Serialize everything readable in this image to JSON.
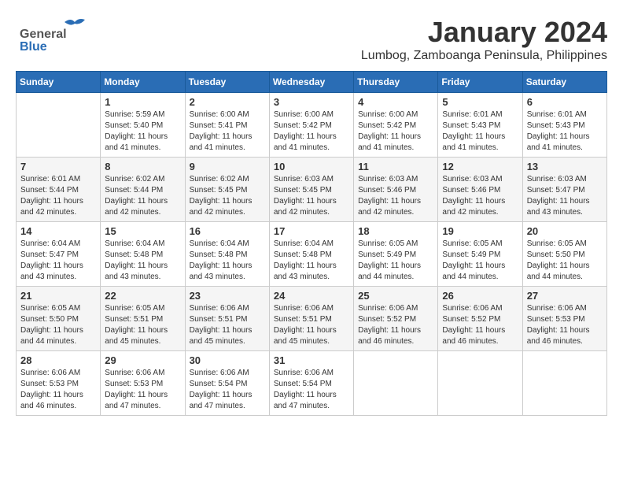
{
  "header": {
    "logo_general": "General",
    "logo_blue": "Blue",
    "month": "January 2024",
    "location": "Lumbog, Zamboanga Peninsula, Philippines"
  },
  "weekdays": [
    "Sunday",
    "Monday",
    "Tuesday",
    "Wednesday",
    "Thursday",
    "Friday",
    "Saturday"
  ],
  "weeks": [
    [
      {
        "day": "",
        "sunrise": "",
        "sunset": "",
        "daylight": ""
      },
      {
        "day": "1",
        "sunrise": "Sunrise: 5:59 AM",
        "sunset": "Sunset: 5:40 PM",
        "daylight": "Daylight: 11 hours and 41 minutes."
      },
      {
        "day": "2",
        "sunrise": "Sunrise: 6:00 AM",
        "sunset": "Sunset: 5:41 PM",
        "daylight": "Daylight: 11 hours and 41 minutes."
      },
      {
        "day": "3",
        "sunrise": "Sunrise: 6:00 AM",
        "sunset": "Sunset: 5:42 PM",
        "daylight": "Daylight: 11 hours and 41 minutes."
      },
      {
        "day": "4",
        "sunrise": "Sunrise: 6:00 AM",
        "sunset": "Sunset: 5:42 PM",
        "daylight": "Daylight: 11 hours and 41 minutes."
      },
      {
        "day": "5",
        "sunrise": "Sunrise: 6:01 AM",
        "sunset": "Sunset: 5:43 PM",
        "daylight": "Daylight: 11 hours and 41 minutes."
      },
      {
        "day": "6",
        "sunrise": "Sunrise: 6:01 AM",
        "sunset": "Sunset: 5:43 PM",
        "daylight": "Daylight: 11 hours and 41 minutes."
      }
    ],
    [
      {
        "day": "7",
        "sunrise": "Sunrise: 6:01 AM",
        "sunset": "Sunset: 5:44 PM",
        "daylight": "Daylight: 11 hours and 42 minutes."
      },
      {
        "day": "8",
        "sunrise": "Sunrise: 6:02 AM",
        "sunset": "Sunset: 5:44 PM",
        "daylight": "Daylight: 11 hours and 42 minutes."
      },
      {
        "day": "9",
        "sunrise": "Sunrise: 6:02 AM",
        "sunset": "Sunset: 5:45 PM",
        "daylight": "Daylight: 11 hours and 42 minutes."
      },
      {
        "day": "10",
        "sunrise": "Sunrise: 6:03 AM",
        "sunset": "Sunset: 5:45 PM",
        "daylight": "Daylight: 11 hours and 42 minutes."
      },
      {
        "day": "11",
        "sunrise": "Sunrise: 6:03 AM",
        "sunset": "Sunset: 5:46 PM",
        "daylight": "Daylight: 11 hours and 42 minutes."
      },
      {
        "day": "12",
        "sunrise": "Sunrise: 6:03 AM",
        "sunset": "Sunset: 5:46 PM",
        "daylight": "Daylight: 11 hours and 42 minutes."
      },
      {
        "day": "13",
        "sunrise": "Sunrise: 6:03 AM",
        "sunset": "Sunset: 5:47 PM",
        "daylight": "Daylight: 11 hours and 43 minutes."
      }
    ],
    [
      {
        "day": "14",
        "sunrise": "Sunrise: 6:04 AM",
        "sunset": "Sunset: 5:47 PM",
        "daylight": "Daylight: 11 hours and 43 minutes."
      },
      {
        "day": "15",
        "sunrise": "Sunrise: 6:04 AM",
        "sunset": "Sunset: 5:48 PM",
        "daylight": "Daylight: 11 hours and 43 minutes."
      },
      {
        "day": "16",
        "sunrise": "Sunrise: 6:04 AM",
        "sunset": "Sunset: 5:48 PM",
        "daylight": "Daylight: 11 hours and 43 minutes."
      },
      {
        "day": "17",
        "sunrise": "Sunrise: 6:04 AM",
        "sunset": "Sunset: 5:48 PM",
        "daylight": "Daylight: 11 hours and 43 minutes."
      },
      {
        "day": "18",
        "sunrise": "Sunrise: 6:05 AM",
        "sunset": "Sunset: 5:49 PM",
        "daylight": "Daylight: 11 hours and 44 minutes."
      },
      {
        "day": "19",
        "sunrise": "Sunrise: 6:05 AM",
        "sunset": "Sunset: 5:49 PM",
        "daylight": "Daylight: 11 hours and 44 minutes."
      },
      {
        "day": "20",
        "sunrise": "Sunrise: 6:05 AM",
        "sunset": "Sunset: 5:50 PM",
        "daylight": "Daylight: 11 hours and 44 minutes."
      }
    ],
    [
      {
        "day": "21",
        "sunrise": "Sunrise: 6:05 AM",
        "sunset": "Sunset: 5:50 PM",
        "daylight": "Daylight: 11 hours and 44 minutes."
      },
      {
        "day": "22",
        "sunrise": "Sunrise: 6:05 AM",
        "sunset": "Sunset: 5:51 PM",
        "daylight": "Daylight: 11 hours and 45 minutes."
      },
      {
        "day": "23",
        "sunrise": "Sunrise: 6:06 AM",
        "sunset": "Sunset: 5:51 PM",
        "daylight": "Daylight: 11 hours and 45 minutes."
      },
      {
        "day": "24",
        "sunrise": "Sunrise: 6:06 AM",
        "sunset": "Sunset: 5:51 PM",
        "daylight": "Daylight: 11 hours and 45 minutes."
      },
      {
        "day": "25",
        "sunrise": "Sunrise: 6:06 AM",
        "sunset": "Sunset: 5:52 PM",
        "daylight": "Daylight: 11 hours and 46 minutes."
      },
      {
        "day": "26",
        "sunrise": "Sunrise: 6:06 AM",
        "sunset": "Sunset: 5:52 PM",
        "daylight": "Daylight: 11 hours and 46 minutes."
      },
      {
        "day": "27",
        "sunrise": "Sunrise: 6:06 AM",
        "sunset": "Sunset: 5:53 PM",
        "daylight": "Daylight: 11 hours and 46 minutes."
      }
    ],
    [
      {
        "day": "28",
        "sunrise": "Sunrise: 6:06 AM",
        "sunset": "Sunset: 5:53 PM",
        "daylight": "Daylight: 11 hours and 46 minutes."
      },
      {
        "day": "29",
        "sunrise": "Sunrise: 6:06 AM",
        "sunset": "Sunset: 5:53 PM",
        "daylight": "Daylight: 11 hours and 47 minutes."
      },
      {
        "day": "30",
        "sunrise": "Sunrise: 6:06 AM",
        "sunset": "Sunset: 5:54 PM",
        "daylight": "Daylight: 11 hours and 47 minutes."
      },
      {
        "day": "31",
        "sunrise": "Sunrise: 6:06 AM",
        "sunset": "Sunset: 5:54 PM",
        "daylight": "Daylight: 11 hours and 47 minutes."
      },
      {
        "day": "",
        "sunrise": "",
        "sunset": "",
        "daylight": ""
      },
      {
        "day": "",
        "sunrise": "",
        "sunset": "",
        "daylight": ""
      },
      {
        "day": "",
        "sunrise": "",
        "sunset": "",
        "daylight": ""
      }
    ]
  ]
}
